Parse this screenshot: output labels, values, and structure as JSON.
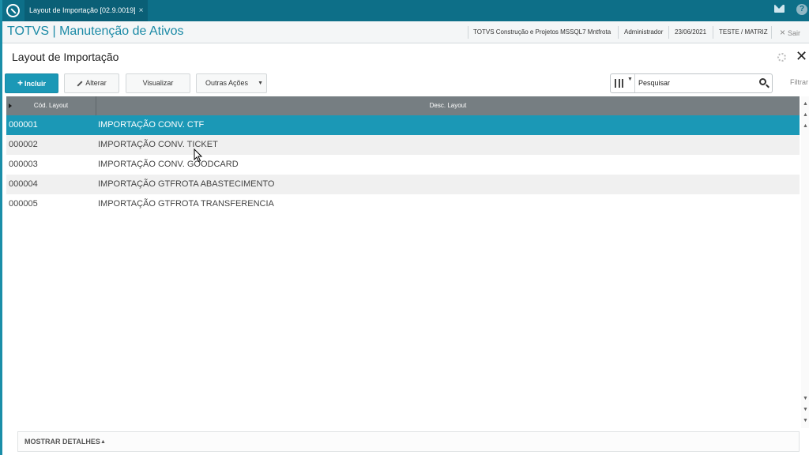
{
  "topbar": {
    "tab_label": "Layout de Importação [02.9.0019]",
    "tab_close": "×",
    "help_label": "?"
  },
  "module": {
    "title": "TOTVS | Manutenção de Ativos",
    "company": "TOTVS Construção e Projetos MSSQL7 Mntfrota",
    "user": "Administrador",
    "date": "23/06/2021",
    "branch": "TESTE / MATRIZ",
    "exit_icon": "×",
    "exit_label": "Sair"
  },
  "page": {
    "title": "Layout de Importação",
    "close_icon": "✕"
  },
  "toolbar": {
    "include_plus": "+",
    "include_label": "Incluir",
    "alter_label": "Alterar",
    "view_label": "Visualizar",
    "more_label": "Outras Ações",
    "more_caret": "▼",
    "columns_caret": "▼",
    "search_placeholder": "Pesquisar",
    "filter_label": "Filtrar"
  },
  "grid": {
    "columns": [
      "Cód. Layout",
      "Desc. Layout"
    ],
    "rows": [
      {
        "code": "000001",
        "desc": "IMPORTAÇÃO CONV. CTF"
      },
      {
        "code": "000002",
        "desc": "IMPORTAÇÃO CONV. TICKET"
      },
      {
        "code": "000003",
        "desc": "IMPORTAÇÃO CONV. GOODCARD"
      },
      {
        "code": "000004",
        "desc": "IMPORTAÇÃO GTFROTA ABASTECIMENTO"
      },
      {
        "code": "000005",
        "desc": "IMPORTAÇÃO GTFROTA TRANSFERENCIA"
      }
    ],
    "selected_row": 0
  },
  "scrollbar": {
    "up": "▲",
    "down": "▼"
  },
  "footer": {
    "details_label": "MOSTRAR DETALHES",
    "details_caret": "▲"
  },
  "colors": {
    "accent": "#1b98b6",
    "topbar": "#0d6f88",
    "grid_header": "#767e82"
  }
}
